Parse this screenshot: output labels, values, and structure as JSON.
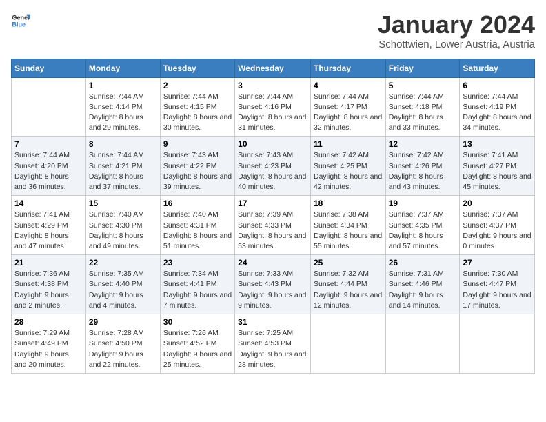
{
  "header": {
    "logo_general": "General",
    "logo_blue": "Blue",
    "month": "January 2024",
    "location": "Schottwien, Lower Austria, Austria"
  },
  "days_of_week": [
    "Sunday",
    "Monday",
    "Tuesday",
    "Wednesday",
    "Thursday",
    "Friday",
    "Saturday"
  ],
  "weeks": [
    [
      {
        "day": "",
        "empty": true
      },
      {
        "day": "1",
        "sunrise": "Sunrise: 7:44 AM",
        "sunset": "Sunset: 4:14 PM",
        "daylight": "Daylight: 8 hours and 29 minutes."
      },
      {
        "day": "2",
        "sunrise": "Sunrise: 7:44 AM",
        "sunset": "Sunset: 4:15 PM",
        "daylight": "Daylight: 8 hours and 30 minutes."
      },
      {
        "day": "3",
        "sunrise": "Sunrise: 7:44 AM",
        "sunset": "Sunset: 4:16 PM",
        "daylight": "Daylight: 8 hours and 31 minutes."
      },
      {
        "day": "4",
        "sunrise": "Sunrise: 7:44 AM",
        "sunset": "Sunset: 4:17 PM",
        "daylight": "Daylight: 8 hours and 32 minutes."
      },
      {
        "day": "5",
        "sunrise": "Sunrise: 7:44 AM",
        "sunset": "Sunset: 4:18 PM",
        "daylight": "Daylight: 8 hours and 33 minutes."
      },
      {
        "day": "6",
        "sunrise": "Sunrise: 7:44 AM",
        "sunset": "Sunset: 4:19 PM",
        "daylight": "Daylight: 8 hours and 34 minutes."
      }
    ],
    [
      {
        "day": "7",
        "sunrise": "Sunrise: 7:44 AM",
        "sunset": "Sunset: 4:20 PM",
        "daylight": "Daylight: 8 hours and 36 minutes."
      },
      {
        "day": "8",
        "sunrise": "Sunrise: 7:44 AM",
        "sunset": "Sunset: 4:21 PM",
        "daylight": "Daylight: 8 hours and 37 minutes."
      },
      {
        "day": "9",
        "sunrise": "Sunrise: 7:43 AM",
        "sunset": "Sunset: 4:22 PM",
        "daylight": "Daylight: 8 hours and 39 minutes."
      },
      {
        "day": "10",
        "sunrise": "Sunrise: 7:43 AM",
        "sunset": "Sunset: 4:23 PM",
        "daylight": "Daylight: 8 hours and 40 minutes."
      },
      {
        "day": "11",
        "sunrise": "Sunrise: 7:42 AM",
        "sunset": "Sunset: 4:25 PM",
        "daylight": "Daylight: 8 hours and 42 minutes."
      },
      {
        "day": "12",
        "sunrise": "Sunrise: 7:42 AM",
        "sunset": "Sunset: 4:26 PM",
        "daylight": "Daylight: 8 hours and 43 minutes."
      },
      {
        "day": "13",
        "sunrise": "Sunrise: 7:41 AM",
        "sunset": "Sunset: 4:27 PM",
        "daylight": "Daylight: 8 hours and 45 minutes."
      }
    ],
    [
      {
        "day": "14",
        "sunrise": "Sunrise: 7:41 AM",
        "sunset": "Sunset: 4:29 PM",
        "daylight": "Daylight: 8 hours and 47 minutes."
      },
      {
        "day": "15",
        "sunrise": "Sunrise: 7:40 AM",
        "sunset": "Sunset: 4:30 PM",
        "daylight": "Daylight: 8 hours and 49 minutes."
      },
      {
        "day": "16",
        "sunrise": "Sunrise: 7:40 AM",
        "sunset": "Sunset: 4:31 PM",
        "daylight": "Daylight: 8 hours and 51 minutes."
      },
      {
        "day": "17",
        "sunrise": "Sunrise: 7:39 AM",
        "sunset": "Sunset: 4:33 PM",
        "daylight": "Daylight: 8 hours and 53 minutes."
      },
      {
        "day": "18",
        "sunrise": "Sunrise: 7:38 AM",
        "sunset": "Sunset: 4:34 PM",
        "daylight": "Daylight: 8 hours and 55 minutes."
      },
      {
        "day": "19",
        "sunrise": "Sunrise: 7:37 AM",
        "sunset": "Sunset: 4:35 PM",
        "daylight": "Daylight: 8 hours and 57 minutes."
      },
      {
        "day": "20",
        "sunrise": "Sunrise: 7:37 AM",
        "sunset": "Sunset: 4:37 PM",
        "daylight": "Daylight: 9 hours and 0 minutes."
      }
    ],
    [
      {
        "day": "21",
        "sunrise": "Sunrise: 7:36 AM",
        "sunset": "Sunset: 4:38 PM",
        "daylight": "Daylight: 9 hours and 2 minutes."
      },
      {
        "day": "22",
        "sunrise": "Sunrise: 7:35 AM",
        "sunset": "Sunset: 4:40 PM",
        "daylight": "Daylight: 9 hours and 4 minutes."
      },
      {
        "day": "23",
        "sunrise": "Sunrise: 7:34 AM",
        "sunset": "Sunset: 4:41 PM",
        "daylight": "Daylight: 9 hours and 7 minutes."
      },
      {
        "day": "24",
        "sunrise": "Sunrise: 7:33 AM",
        "sunset": "Sunset: 4:43 PM",
        "daylight": "Daylight: 9 hours and 9 minutes."
      },
      {
        "day": "25",
        "sunrise": "Sunrise: 7:32 AM",
        "sunset": "Sunset: 4:44 PM",
        "daylight": "Daylight: 9 hours and 12 minutes."
      },
      {
        "day": "26",
        "sunrise": "Sunrise: 7:31 AM",
        "sunset": "Sunset: 4:46 PM",
        "daylight": "Daylight: 9 hours and 14 minutes."
      },
      {
        "day": "27",
        "sunrise": "Sunrise: 7:30 AM",
        "sunset": "Sunset: 4:47 PM",
        "daylight": "Daylight: 9 hours and 17 minutes."
      }
    ],
    [
      {
        "day": "28",
        "sunrise": "Sunrise: 7:29 AM",
        "sunset": "Sunset: 4:49 PM",
        "daylight": "Daylight: 9 hours and 20 minutes."
      },
      {
        "day": "29",
        "sunrise": "Sunrise: 7:28 AM",
        "sunset": "Sunset: 4:50 PM",
        "daylight": "Daylight: 9 hours and 22 minutes."
      },
      {
        "day": "30",
        "sunrise": "Sunrise: 7:26 AM",
        "sunset": "Sunset: 4:52 PM",
        "daylight": "Daylight: 9 hours and 25 minutes."
      },
      {
        "day": "31",
        "sunrise": "Sunrise: 7:25 AM",
        "sunset": "Sunset: 4:53 PM",
        "daylight": "Daylight: 9 hours and 28 minutes."
      },
      {
        "day": "",
        "empty": true
      },
      {
        "day": "",
        "empty": true
      },
      {
        "day": "",
        "empty": true
      }
    ]
  ]
}
